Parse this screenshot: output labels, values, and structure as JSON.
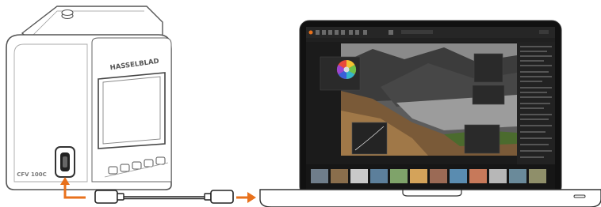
{
  "camera": {
    "brand": "HASSELBLAD",
    "model": "CFV 100C"
  },
  "colors": {
    "accent_arrow": "#e8711c",
    "outline": "#555555",
    "screen_dark": "#1b1b1b",
    "body_fill": "#ffffff"
  },
  "icons": [
    "usb-c-port-icon",
    "usb-c-cable-icon",
    "arrow-right-icon",
    "color-wheel-icon"
  ]
}
